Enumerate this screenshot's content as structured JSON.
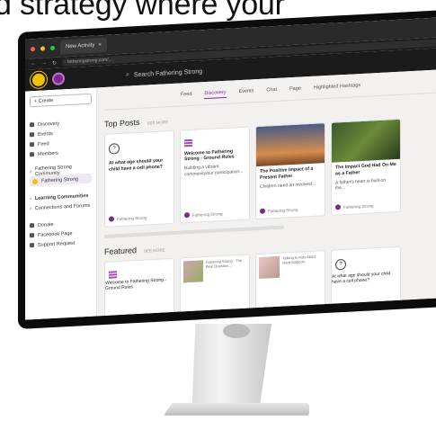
{
  "headline": "d strategy where your",
  "browser": {
    "tab_label": "New Activity",
    "url": "fatheringstrong.com/..."
  },
  "app": {
    "search_placeholder": "Search Fathering Strong",
    "tabs": [
      "Feed",
      "Discovery",
      "Events",
      "Chat",
      "Page",
      "Highlighted Hashtags"
    ],
    "active_tab": 1
  },
  "sidebar": {
    "create": "+ Create",
    "items": [
      "Discovery",
      "Events",
      "Feed",
      "Members"
    ],
    "community_heading": "Fathering Strong Community",
    "community_item": "Fathering Strong",
    "learning": "Learning Communities",
    "connections": "Connections and Forums",
    "links": [
      "Donate",
      "Facebook Page",
      "Support Request"
    ]
  },
  "top_posts": {
    "title": "Top Posts",
    "see_all": "SEE MORE",
    "cards": [
      {
        "title": "At what age should your child have a cell phone?",
        "sub": "",
        "author": "Fathering Strong"
      },
      {
        "title": "Welcome to Fathering Strong - Ground Rules",
        "sub": "Building a vibrant community/our participation...",
        "author": "Fathering Strong"
      },
      {
        "title": "The Positive Impact of a Present Father",
        "sub": "Children need an involved...",
        "author": "Fathering Strong"
      },
      {
        "title": "The Impact God Had On Me as a Father",
        "sub": "A father's heart is built on the...",
        "author": "Fathering Strong"
      }
    ]
  },
  "featured": {
    "title": "Featured",
    "see_all": "SEE MORE",
    "cards": [
      {
        "title": "Welcome to Fathering Strong - Ground Rules",
        "text": ""
      },
      {
        "title": "",
        "text": "Fathering Strong - The Real Question..."
      },
      {
        "title": "",
        "text": "Talking to Kids About Hard Subjects"
      },
      {
        "title": "At what age should your child have a cell phone?",
        "text": ""
      }
    ]
  }
}
